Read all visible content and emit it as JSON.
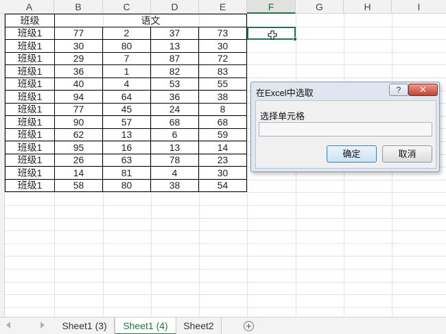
{
  "columns": [
    "A",
    "B",
    "C",
    "D",
    "E",
    "F",
    "G",
    "H",
    "I"
  ],
  "header_row": {
    "a": "班级",
    "merged": "语文"
  },
  "rows": [
    [
      "班级1",
      "77",
      "2",
      "37",
      "73"
    ],
    [
      "班级1",
      "30",
      "80",
      "13",
      "30"
    ],
    [
      "班级1",
      "29",
      "7",
      "87",
      "72"
    ],
    [
      "班级1",
      "36",
      "1",
      "82",
      "83"
    ],
    [
      "班级1",
      "40",
      "4",
      "53",
      "55"
    ],
    [
      "班级1",
      "94",
      "64",
      "36",
      "38"
    ],
    [
      "班级1",
      "77",
      "45",
      "24",
      "8"
    ],
    [
      "班级1",
      "90",
      "57",
      "68",
      "68"
    ],
    [
      "班级1",
      "62",
      "13",
      "6",
      "59"
    ],
    [
      "班级1",
      "95",
      "16",
      "13",
      "14"
    ],
    [
      "班级1",
      "26",
      "63",
      "78",
      "23"
    ],
    [
      "班级1",
      "14",
      "81",
      "4",
      "30"
    ],
    [
      "班级1",
      "58",
      "80",
      "38",
      "54"
    ]
  ],
  "active_column": "F",
  "dialog": {
    "title": "在Excel中选取",
    "help_label": "?",
    "close_label": "✕",
    "label": "选择单元格",
    "input_value": "",
    "ok_label": "确定",
    "cancel_label": "取消"
  },
  "tabs": [
    {
      "label": "Sheet1 (3)",
      "active": false
    },
    {
      "label": "Sheet1 (4)",
      "active": true
    },
    {
      "label": "Sheet2",
      "active": false
    }
  ],
  "add_sheet_label": "+",
  "icons": {
    "cursor": "plus-cursor-icon",
    "nav_prev": "triangle-left-icon",
    "nav_next": "triangle-right-icon"
  },
  "colors": {
    "accent": "#217346",
    "dialog_close": "#c2432f"
  }
}
